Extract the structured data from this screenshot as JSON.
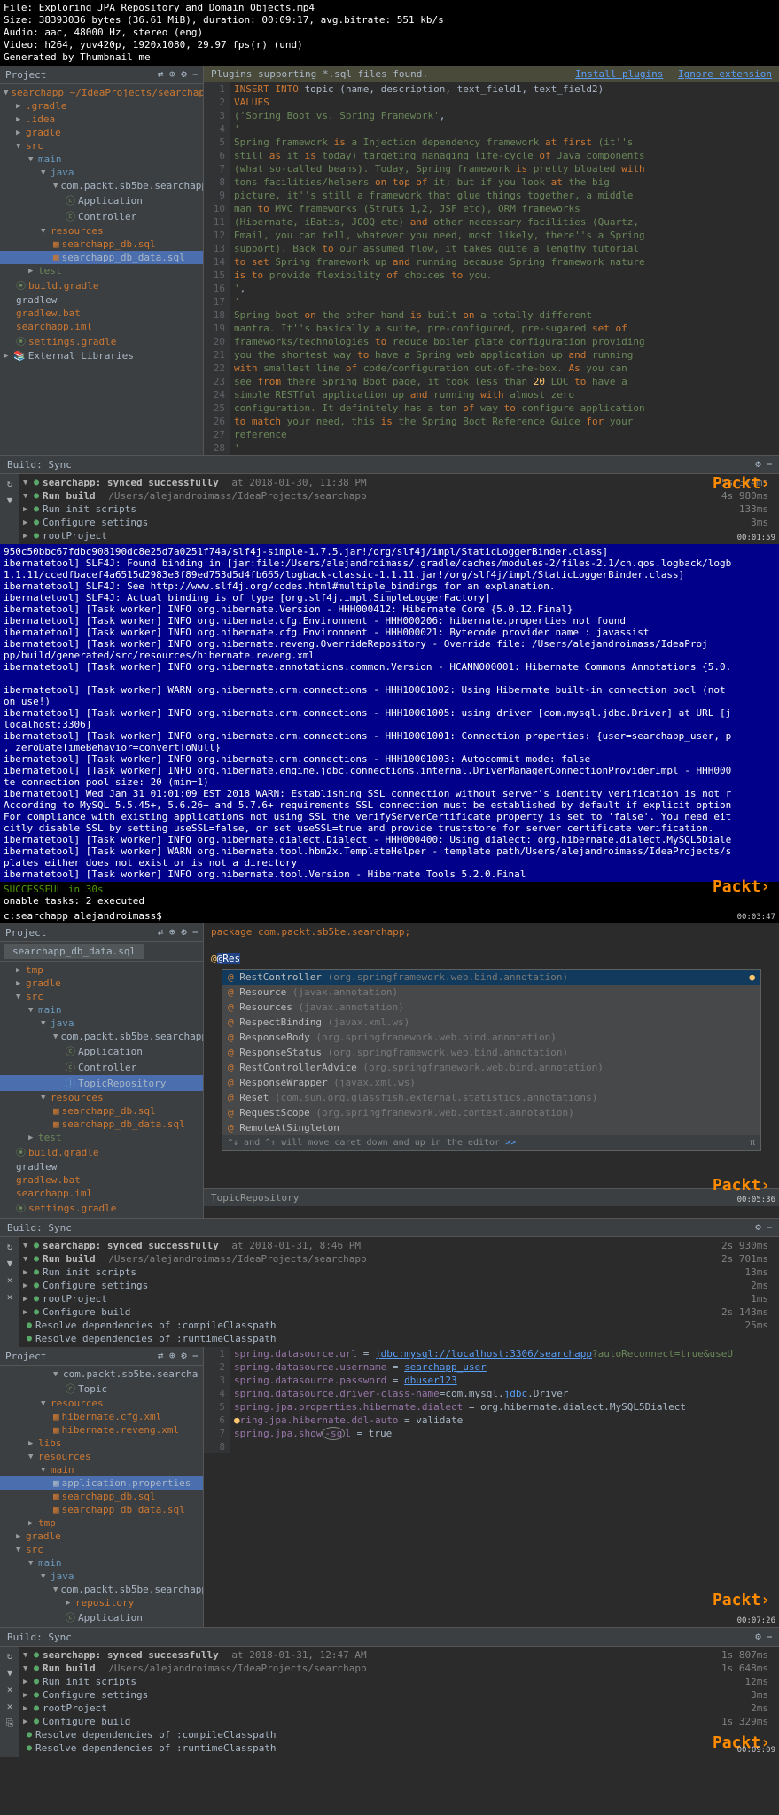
{
  "header": {
    "file": "File: Exploring JPA Repository and Domain Objects.mp4",
    "size": "Size: 38393036 bytes (36.61 MiB), duration: 00:09:17, avg.bitrate: 551 kb/s",
    "audio": "Audio: aac, 48000 Hz, stereo (eng)",
    "video": "Video: h264, yuv420p, 1920x1080, 29.97 fps(r) (und)",
    "gen": "Generated by Thumbnail me"
  },
  "section1": {
    "project_label": "Project",
    "breadcrumb": "searchapp ~/IdeaProjects/searchapp",
    "tree": {
      "gradle_hidden": ".gradle",
      "idea": ".idea",
      "gradle": "gradle",
      "src": "src",
      "main": "main",
      "java": "java",
      "pkg": "com.packt.sb5be.searchapp",
      "application": "Application",
      "controller": "Controller",
      "resources": "resources",
      "db_sql": "searchapp_db.sql",
      "db_data_sql": "searchapp_db_data.sql",
      "test": "test",
      "build_gradle": "build.gradle",
      "gradlew": "gradlew",
      "gradlew_bat": "gradlew.bat",
      "gradlew_iml": "searchapp.iml",
      "settings_gradle": "settings.gradle",
      "ext_libs": "External Libraries"
    },
    "notice": "Plugins supporting *.sql files found.",
    "install": "Install plugins",
    "ignore": "Ignore extension",
    "lines": [
      "1",
      "2",
      "3",
      "4",
      "5",
      "6",
      "7",
      "8",
      "9",
      "10",
      "11",
      "12",
      "13",
      "14",
      "15",
      "16",
      "17",
      "18",
      "19",
      "20",
      "21",
      "22",
      "23",
      "24",
      "25",
      "26",
      "27",
      "28"
    ]
  },
  "build1": {
    "label": "Build: Sync",
    "root": "searchapp: synced successfully",
    "root_time": "at 2018-01-30, 11:38 PM",
    "root_dur": "5s 374ms",
    "run_build": "Run build",
    "run_build_path": "/Users/alejandroimass/IdeaProjects/searchapp",
    "run_build_dur": "4s 980ms",
    "run_init": "Run init scripts",
    "run_init_dur": "133ms",
    "configure": "Configure settings",
    "configure_dur": "3ms",
    "root_proj": "rootProject",
    "ts": "00:01:59"
  },
  "console1": "950c50bbc67fdbc908190dc8e25d7a0251f74a/slf4j-simple-1.7.5.jar!/org/slf4j/impl/StaticLoggerBinder.class]\nibernatetool] SLF4J: Found binding in [jar:file:/Users/alejandroimass/.gradle/caches/modules-2/files-2.1/ch.qos.logback/logb\n1.1.11/ccedfbacef4a6515d2983e3f89ed753d5d4fb665/logback-classic-1.1.11.jar!/org/slf4j/impl/StaticLoggerBinder.class]\nibernatetool] SLF4J: See http://www.slf4j.org/codes.html#multiple_bindings for an explanation.\nibernatetool] SLF4J: Actual binding is of type [org.slf4j.impl.SimpleLoggerFactory]\nibernatetool] [Task worker] INFO org.hibernate.Version - HHH000412: Hibernate Core {5.0.12.Final}\nibernatetool] [Task worker] INFO org.hibernate.cfg.Environment - HHH000206: hibernate.properties not found\nibernatetool] [Task worker] INFO org.hibernate.cfg.Environment - HHH000021: Bytecode provider name : javassist\nibernatetool] [Task worker] INFO org.hibernate.reveng.OverrideRepository - Override file: /Users/alejandroimass/IdeaProj\npp/build/generated/src/resources/hibernate.reveng.xml\nibernatetool] [Task worker] INFO org.hibernate.annotations.common.Version - HCANN000001: Hibernate Commons Annotations {5.0.\n\nibernatetool] [Task worker] WARN org.hibernate.orm.connections - HHH10001002: Using Hibernate built-in connection pool (not \non use!)\nibernatetool] [Task worker] INFO org.hibernate.orm.connections - HHH10001005: using driver [com.mysql.jdbc.Driver] at URL [j\nlocalhost:3306]\nibernatetool] [Task worker] INFO org.hibernate.orm.connections - HHH10001001: Connection properties: {user=searchapp_user, p\n, zeroDateTimeBehavior=convertToNull}\nibernatetool] [Task worker] INFO org.hibernate.orm.connections - HHH10001003: Autocommit mode: false\nibernatetool] [Task worker] INFO org.hibernate.engine.jdbc.connections.internal.DriverManagerConnectionProviderImpl - HHH000\nte connection pool size: 20 (min=1)\nibernatetool] Wed Jan 31 01:01:09 EST 2018 WARN: Establishing SSL connection without server's identity verification is not r\nAccording to MySQL 5.5.45+, 5.6.26+ and 5.7.6+ requirements SSL connection must be established by default if explicit option\nFor compliance with existing applications not using SSL the verifyServerCertificate property is set to 'false'. You need eit\ncitly disable SSL by setting useSSL=false, or set useSSL=true and provide truststore for server certificate verification.\nibernatetool] [Task worker] INFO org.hibernate.dialect.Dialect - HHH000400: Using dialect: org.hibernate.dialect.MySQL5Diale\nibernatetool] [Task worker] WARN org.hibernate.tool.hbm2x.TemplateHelper - template path/Users/alejandroimass/IdeaProjects/s\nplates either does not exist or is not a directory\nibernatetool] [Task worker] INFO org.hibernate.tool.Version - Hibernate Tools 5.2.0.Final\n",
  "console_success": {
    "l1": "SUCCESSFUL in 30s",
    "l2": "onable tasks: 2 executed",
    "l3": "c:searchapp alejandroimass$ ",
    "ts": "00:03:47"
  },
  "section2": {
    "project_label": "Project",
    "tab": "searchapp_db_data.sql",
    "pkg_stmt": "package com.packt.sb5be.searchapp;",
    "input": "@Res",
    "tree": {
      "tmp": "tmp",
      "gradle": "gradle",
      "src": "src",
      "main": "main",
      "java": "java",
      "pkg": "com.packt.sb5be.searchapp",
      "application": "Application",
      "controller": "Controller",
      "topic_repo": "TopicRepository",
      "resources": "resources",
      "db_sql": "searchapp_db.sql",
      "db_data_sql": "searchapp_db_data.sql",
      "test": "test",
      "build_gradle": "build.gradle",
      "gradlew": "gradlew",
      "gradlew_bat": "gradlew.bat",
      "gradlew_iml": "searchapp.iml",
      "settings_gradle": "settings.gradle"
    },
    "autocomplete": [
      {
        "name": "RestController",
        "hint": "(org.springframework.web.bind.annotation)"
      },
      {
        "name": "Resource",
        "hint": "(javax.annotation)"
      },
      {
        "name": "Resources",
        "hint": "(javax.annotation)"
      },
      {
        "name": "RespectBinding",
        "hint": "(javax.xml.ws)"
      },
      {
        "name": "ResponseBody",
        "hint": "(org.springframework.web.bind.annotation)"
      },
      {
        "name": "ResponseStatus",
        "hint": "(org.springframework.web.bind.annotation)"
      },
      {
        "name": "RestControllerAdvice",
        "hint": "(org.springframework.web.bind.annotation)"
      },
      {
        "name": "ResponseWrapper",
        "hint": "(javax.xml.ws)"
      },
      {
        "name": "Reset",
        "hint": "(com.sun.org.glassfish.external.statistics.annotations)"
      },
      {
        "name": "RequestScope",
        "hint": "(org.springframework.web.context.annotation)"
      },
      {
        "name": "RemoteAtSingleton",
        "hint": ""
      }
    ],
    "ac_footer": "^↓ and ^↑ will move caret down and up in the editor",
    "ac_footer_link": ">>",
    "status": "TopicRepository",
    "ts": "00:05:36"
  },
  "build2": {
    "label": "Build: Sync",
    "root": "searchapp: synced successfully",
    "root_time": "at 2018-01-31, 8:46 PM",
    "root_dur": "2s 930ms",
    "run_build": "Run build",
    "run_build_path": "/Users/alejandroimass/IdeaProjects/searchapp",
    "run_build_dur": "2s 701ms",
    "run_init": "Run init scripts",
    "run_init_dur": "13ms",
    "configure": "Configure settings",
    "configure_dur": "2ms",
    "root_proj": "rootProject",
    "root_proj_dur": "1ms",
    "configure_build": "Configure build",
    "configure_build_dur": "2s 143ms",
    "resolve_compile": "Resolve dependencies of :compileClasspath",
    "resolve_compile_dur": "25ms",
    "resolve_runtime": "Resolve dependencies of :runtimeClasspath"
  },
  "section3": {
    "project_label": "Project",
    "tree": {
      "pkg": "com.packt.sb5be.searcha",
      "topic": "Topic",
      "resources": "resources",
      "hib_cfg": "hibernate.cfg.xml",
      "hib_reveng": "hibernate.reveng.xml",
      "libs": "libs",
      "resources2": "resources",
      "main": "main",
      "app_props": "application.properties",
      "db_sql": "searchapp_db.sql",
      "db_data_sql": "searchapp_db_data.sql",
      "tmp": "tmp",
      "gradle": "gradle",
      "src": "src",
      "main2": "main",
      "java": "java",
      "pkg2": "com.packt.sb5be.searchapp",
      "repository": "repository",
      "application": "Application"
    },
    "lines": [
      "1",
      "2",
      "3",
      "4",
      "5",
      "6",
      "7",
      "8"
    ],
    "ts": "00:07:26"
  },
  "build3": {
    "label": "Build: Sync",
    "root": "searchapp: synced successfully",
    "root_time": "at 2018-01-31, 12:47 AM",
    "root_dur": "1s 807ms",
    "run_build": "Run build",
    "run_build_path": "/Users/alejandroimass/IdeaProjects/searchapp",
    "run_build_dur": "1s 648ms",
    "run_init": "Run init scripts",
    "run_init_dur": "12ms",
    "configure": "Configure settings",
    "configure_dur": "3ms",
    "root_proj": "rootProject",
    "root_proj_dur": "2ms",
    "configure_build": "Configure build",
    "configure_build_dur": "1s 329ms",
    "resolve_compile": "Resolve dependencies of :compileClasspath",
    "resolve_runtime": "Resolve dependencies of :runtimeClasspath",
    "ts": "00:09:09"
  }
}
